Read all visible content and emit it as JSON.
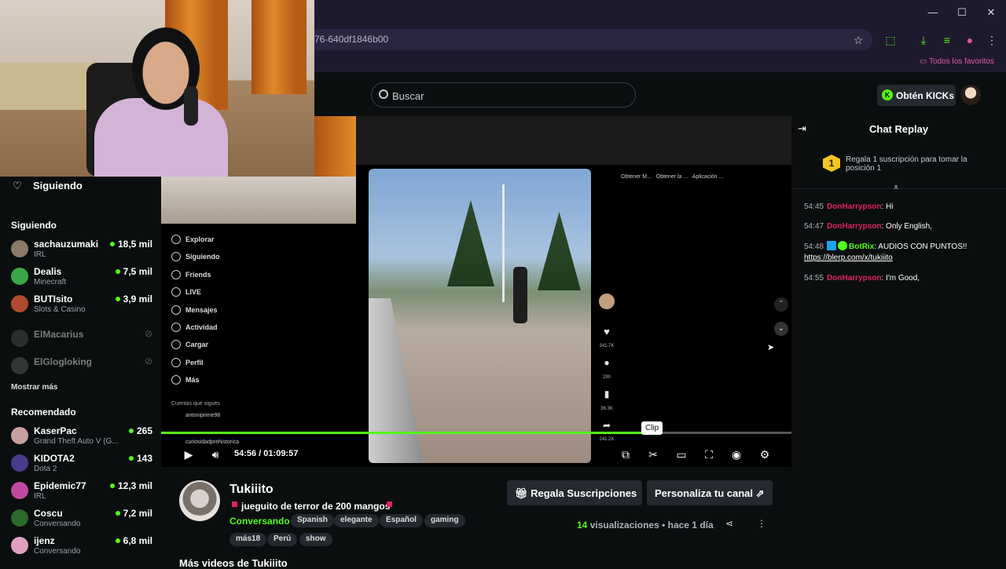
{
  "browser": {
    "url": "76-640df1846b00",
    "bookmark_all": "Todos los favoritos"
  },
  "header": {
    "search_placeholder": "Buscar",
    "kicks_label": "Obtén KICKs"
  },
  "sidebar": {
    "following_header": "Siguiendo",
    "following_title": "Siguiendo",
    "following": [
      {
        "name": "sachauzumaki",
        "category": "IRL",
        "viewers": "18,5 mil",
        "live": true,
        "color": "#8a7a6a"
      },
      {
        "name": "Dealis",
        "category": "Minecraft",
        "viewers": "7,5 mil",
        "live": true,
        "color": "#3aa64a"
      },
      {
        "name": "BUTIsito",
        "category": "Slots & Casino",
        "viewers": "3,9 mil",
        "live": true,
        "color": "#b24a30"
      },
      {
        "name": "ElMacarius",
        "category": "",
        "viewers": "",
        "live": false,
        "color": "#555"
      },
      {
        "name": "ElGlogloking",
        "category": "",
        "viewers": "",
        "live": false,
        "color": "#666"
      }
    ],
    "show_more": "Mostrar más",
    "recommended_title": "Recomendado",
    "recommended": [
      {
        "name": "KaserPac",
        "category": "Grand Theft Auto V (G...",
        "viewers": "265",
        "color": "#c9a0a0"
      },
      {
        "name": "KIDOTA2",
        "category": "Dota 2",
        "viewers": "143",
        "color": "#4a3a8a"
      },
      {
        "name": "Epidemic77",
        "category": "IRL",
        "viewers": "12,3 mil",
        "color": "#c04aa0"
      },
      {
        "name": "Coscu",
        "category": "Conversando",
        "viewers": "7,2 mil",
        "color": "#2a6a2a"
      },
      {
        "name": "ijenz",
        "category": "Conversando",
        "viewers": "6,8 mil",
        "color": "#e0a0c0"
      }
    ]
  },
  "video": {
    "time": "54:56 / 01:09:57",
    "progress": 0.785,
    "clip_tooltip": "Clip",
    "tiktok_nav": [
      "Explorar",
      "Siguiendo",
      "Friends",
      "LIVE",
      "Mensajes",
      "Actividad",
      "Cargar",
      "Perfil",
      "Más"
    ],
    "tiktok_following_label": "Cuentas que sigues",
    "tiktok_accounts": [
      "antoniprime96",
      "curiosidadprehistorica"
    ],
    "tiktok_counts": [
      "341.7K",
      "290",
      "36.3K",
      "241.2K"
    ],
    "tiktok_topbar": [
      "Obtener M...",
      "Obtener la ...",
      "Aplicación ..."
    ]
  },
  "stream": {
    "channel": "Tukiiito",
    "title": "jueguito de terror de 200 mangos",
    "category": "Conversando",
    "tags": [
      "Spanish",
      "elegante",
      "Español",
      "gaming",
      "más18",
      "Perú",
      "show"
    ],
    "gift_btn": "Regala Suscripciones",
    "customize_btn": "Personaliza tu canal",
    "views_count": "14",
    "views_label": "visualizaciones",
    "time_ago": "hace 1 día",
    "more_videos": "Más videos de Tukiiito"
  },
  "chat": {
    "title": "Chat Replay",
    "pin_rank": "1",
    "pin_text": "Regala 1 suscripción para tomar la posición 1",
    "messages": [
      {
        "time": "54:45",
        "user": "DonHarrypson",
        "text": ": Hi",
        "color": "#e0245e"
      },
      {
        "time": "54:47",
        "user": "DonHarrypson",
        "text": ": Only English,",
        "color": "#e0245e"
      },
      {
        "time": "54:48",
        "user": "BotRix",
        "text": ": AUDIOS CON PUNTOS!!",
        "link": "https://blerp.com/x/tukiiito",
        "color": "#53fc18"
      },
      {
        "time": "54:55",
        "user": "DonHarrypson",
        "text": ": I'm Good,",
        "color": "#e0245e"
      }
    ]
  }
}
